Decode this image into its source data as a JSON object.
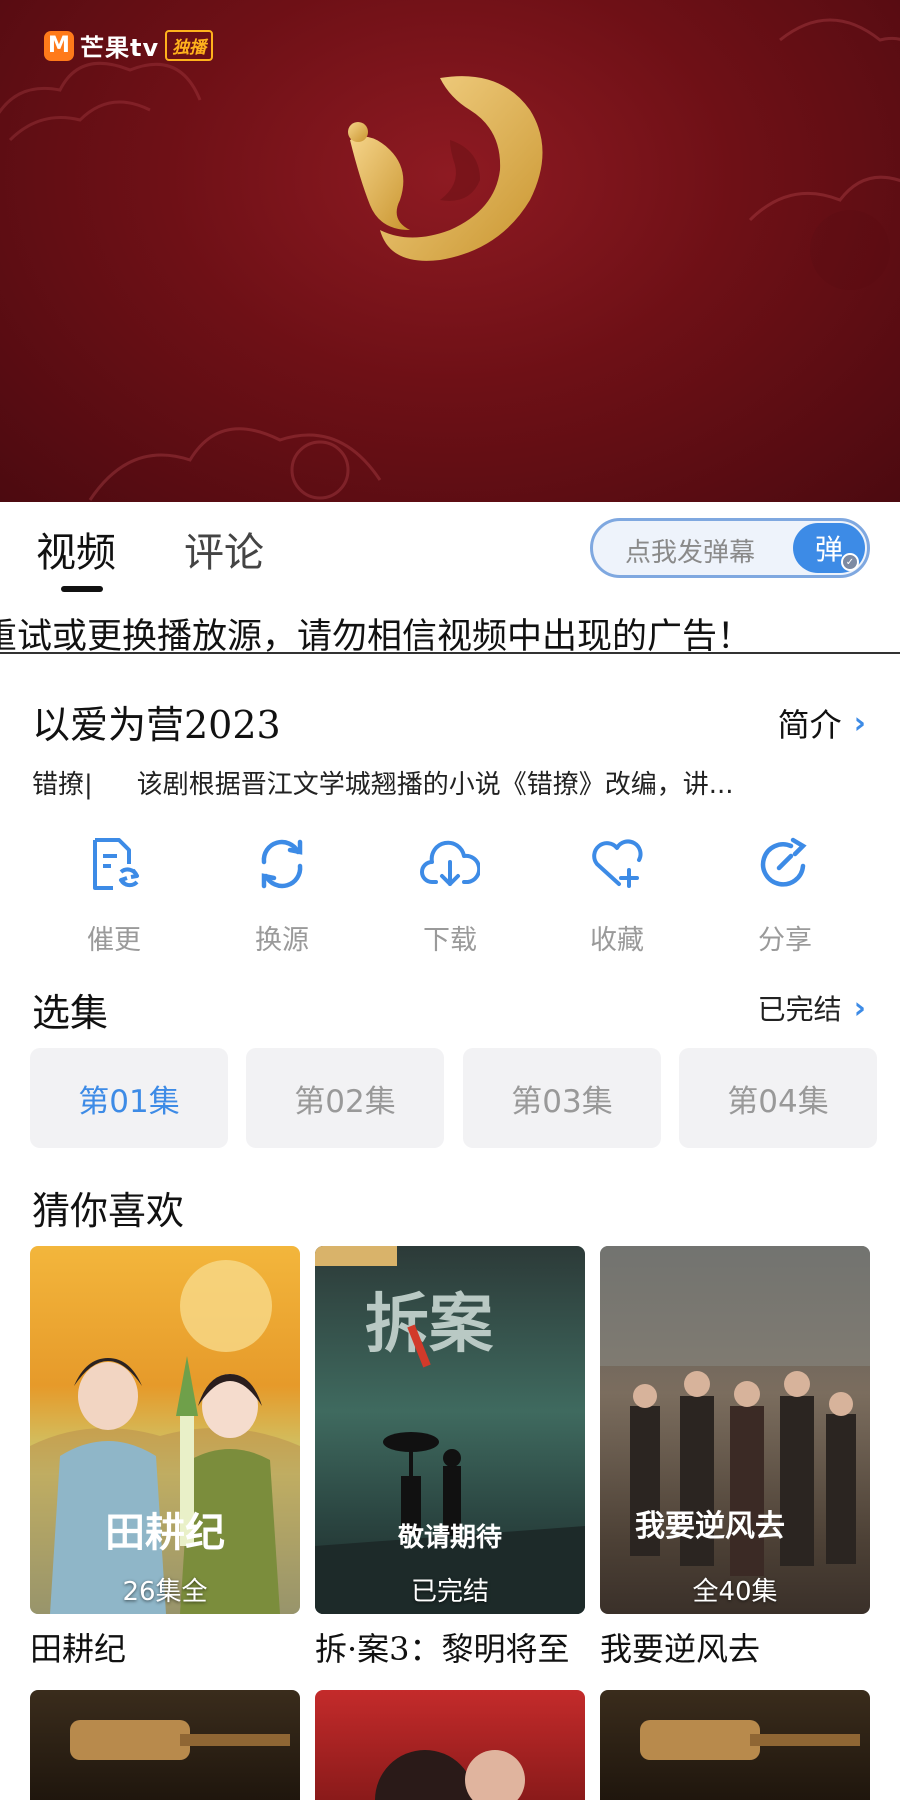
{
  "player": {
    "brand": "芒果tv",
    "brand_badge": "独播",
    "logo_letter": "M"
  },
  "tabs": {
    "video": "视频",
    "comment": "评论"
  },
  "danmaku": {
    "placeholder": "点我发弹幕",
    "button": "弹"
  },
  "notice": "重试或更换播放源，请勿相信视频中出现的广告！",
  "show": {
    "title": "以爱为营2023",
    "intro_label": "简介",
    "tag": "错撩|",
    "description": "该剧根据晋江文学城翘播的小说《错撩》改编，讲..."
  },
  "actions": [
    {
      "label": "催更",
      "icon": "update-request-icon"
    },
    {
      "label": "换源",
      "icon": "switch-source-icon"
    },
    {
      "label": "下载",
      "icon": "cloud-download-icon"
    },
    {
      "label": "收藏",
      "icon": "heart-plus-icon"
    },
    {
      "label": "分享",
      "icon": "share-icon"
    }
  ],
  "episodes": {
    "title": "选集",
    "status": "已完结",
    "items": [
      "第01集",
      "第02集",
      "第03集",
      "第04集"
    ]
  },
  "recommend": {
    "title": "猜你喜欢",
    "items": [
      {
        "name": "田耕纪",
        "badge": "26集全"
      },
      {
        "name": "拆·案3：黎明将至",
        "badge": "已完结"
      },
      {
        "name": "我要逆风去",
        "badge": "全40集"
      }
    ]
  },
  "colors": {
    "accent": "#3d8be6",
    "player_bg": "#6e1016",
    "brand_orange": "#ff7a1a",
    "brand_gold": "#ffb21c"
  }
}
